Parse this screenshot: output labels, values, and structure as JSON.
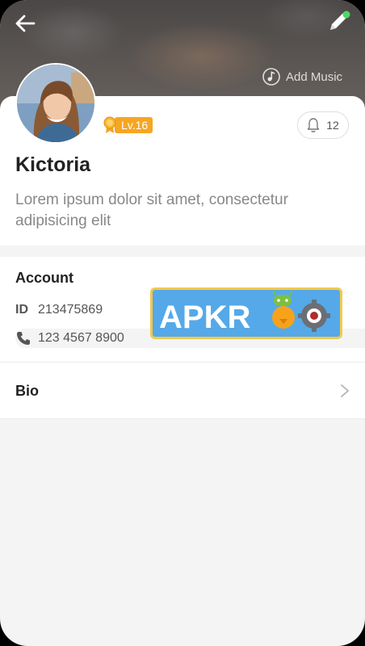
{
  "header": {
    "back_icon": "arrow-left-icon",
    "edit_icon": "pencil-icon",
    "add_music_label": "Add Music",
    "add_music_icon": "music-note-icon"
  },
  "profile": {
    "name": "Kictoria",
    "level_label": "Lv.16",
    "likes_count": "12",
    "bio": "Lorem ipsum dolor sit amet, consectetur adipisicing elit"
  },
  "account": {
    "title": "Account",
    "id_label": "ID",
    "id_value": "213475869",
    "phone_value": "123 4567 8900"
  },
  "bio_row": {
    "label": "Bio"
  },
  "watermark": {
    "text": "APKROO"
  },
  "colors": {
    "level_badge": "#f6a623",
    "edit_pen": "#4cd964",
    "logo_bg": "#55a9e8",
    "logo_border": "#f2c94c"
  }
}
